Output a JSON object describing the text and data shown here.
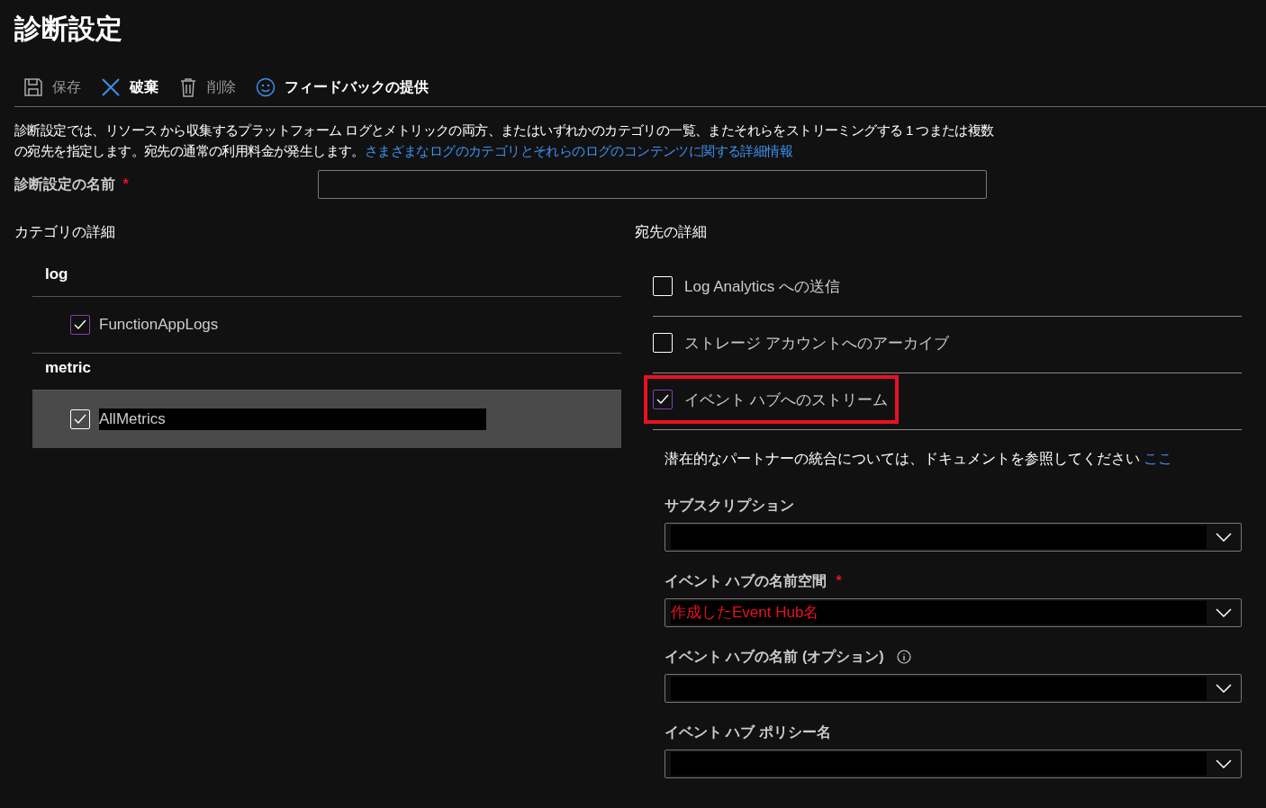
{
  "title": "診断設定",
  "toolbar": [
    {
      "kind": "save",
      "label": "保存",
      "disabled": true
    },
    {
      "kind": "discard",
      "label": "破棄",
      "disabled": false
    },
    {
      "kind": "delete",
      "label": "削除",
      "disabled": true
    },
    {
      "kind": "feedback",
      "label": "フィードバックの提供",
      "disabled": false
    }
  ],
  "description": {
    "text": "診断設定では、リソース から収集するプラットフォーム ログとメトリックの両方、またはいずれかのカテゴリの一覧、またそれらをストリーミングする 1 つまたは複数の宛先を指定します。宛先の通常の利用料金が発生します。",
    "link": "さまざまなログのカテゴリとそれらのログのコンテンツに関する詳細情報"
  },
  "name_field": {
    "label": "診断設定の名前",
    "required_mark": "*"
  },
  "categories": {
    "heading": "カテゴリの詳細",
    "groups": [
      {
        "name": "log",
        "items": [
          {
            "label": "FunctionAppLogs",
            "checked": true,
            "selected": false,
            "redacted": false
          }
        ]
      },
      {
        "name": "metric",
        "items": [
          {
            "label": "AllMetrics",
            "checked": true,
            "selected": true,
            "redacted": true
          }
        ]
      }
    ]
  },
  "destinations": {
    "heading": "宛先の詳細",
    "items": [
      {
        "label": "Log Analytics への送信",
        "checked": false,
        "highlighted": false
      },
      {
        "label": "ストレージ アカウントへのアーカイブ",
        "checked": false,
        "highlighted": false
      },
      {
        "label": "イベント ハブへのストリーム",
        "checked": true,
        "highlighted": true
      }
    ],
    "note": {
      "text": "潜在的なパートナーの統合については、ドキュメントを参照してください",
      "link": "ここ"
    },
    "fields": [
      {
        "label": "サブスクリプション",
        "redacted": true
      },
      {
        "label": "イベント ハブの名前空間",
        "required_mark": "*",
        "value": "作成したEvent Hub名",
        "redacted": true
      },
      {
        "label": "イベント ハブの名前 (オプション)",
        "info": true,
        "redacted": true
      },
      {
        "label": "イベント ハブ ポリシー名",
        "redacted": true
      }
    ]
  }
}
